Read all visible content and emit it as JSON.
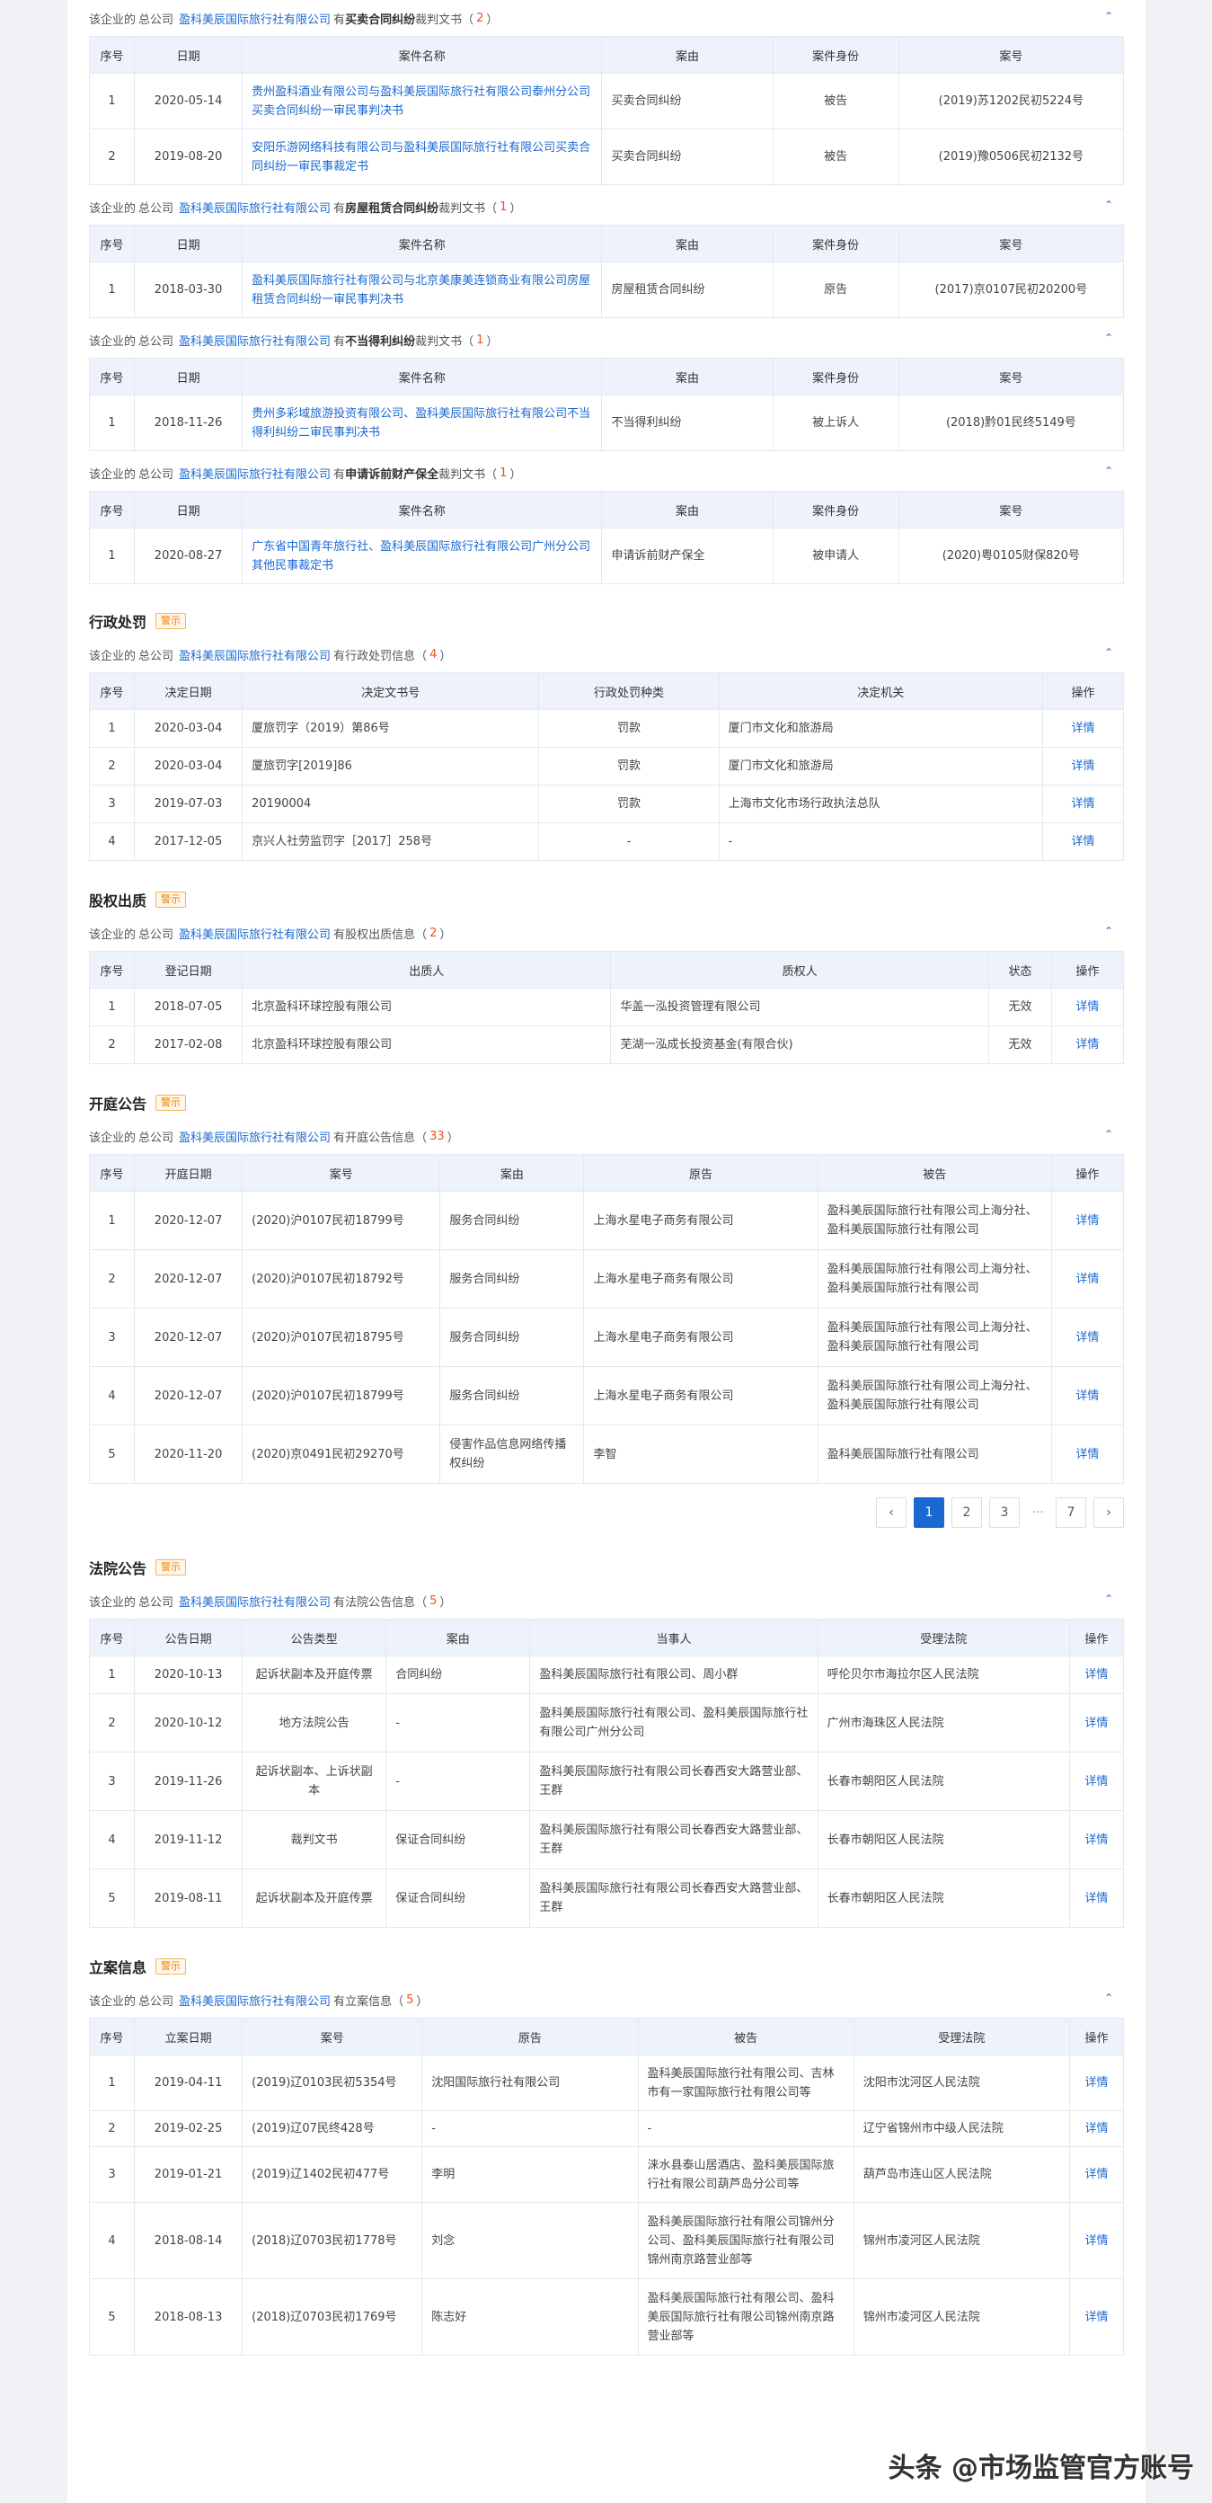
{
  "company": "盈科美辰国际旅行社有限公司",
  "common": {
    "prefix": "该企业的",
    "parent": "总公司",
    "has": "有",
    "paren_open": "（",
    "paren_close": "）",
    "detail": "详情",
    "warn_badge": "警示",
    "collapse": "⌃"
  },
  "judgments": [
    {
      "keyword": "买卖合同纠纷",
      "suffix": "裁判文书",
      "count": "2",
      "headers": [
        "序号",
        "日期",
        "案件名称",
        "案由",
        "案件身份",
        "案号"
      ],
      "rows": [
        [
          "1",
          "2020-05-14",
          "贵州盈科酒业有限公司与盈科美辰国际旅行社有限公司泰州分公司买卖合同纠纷一审民事判决书",
          "买卖合同纠纷",
          "被告",
          "(2019)苏1202民初5224号"
        ],
        [
          "2",
          "2019-08-20",
          "安阳乐游网络科技有限公司与盈科美辰国际旅行社有限公司买卖合同纠纷一审民事裁定书",
          "买卖合同纠纷",
          "被告",
          "(2019)豫0506民初2132号"
        ]
      ]
    },
    {
      "keyword": "房屋租赁合同纠纷",
      "suffix": "裁判文书",
      "count": "1",
      "headers": [
        "序号",
        "日期",
        "案件名称",
        "案由",
        "案件身份",
        "案号"
      ],
      "rows": [
        [
          "1",
          "2018-03-30",
          "盈科美辰国际旅行社有限公司与北京美康美连锁商业有限公司房屋租赁合同纠纷一审民事判决书",
          "房屋租赁合同纠纷",
          "原告",
          "(2017)京0107民初20200号"
        ]
      ]
    },
    {
      "keyword": "不当得利纠纷",
      "suffix": "裁判文书",
      "count": "1",
      "headers": [
        "序号",
        "日期",
        "案件名称",
        "案由",
        "案件身份",
        "案号"
      ],
      "rows": [
        [
          "1",
          "2018-11-26",
          "贵州多彩域旅游投资有限公司、盈科美辰国际旅行社有限公司不当得利纠纷二审民事判决书",
          "不当得利纠纷",
          "被上诉人",
          "(2018)黔01民终5149号"
        ]
      ]
    },
    {
      "keyword": "申请诉前财产保全",
      "suffix": "裁判文书",
      "count": "1",
      "headers": [
        "序号",
        "日期",
        "案件名称",
        "案由",
        "案件身份",
        "案号"
      ],
      "rows": [
        [
          "1",
          "2020-08-27",
          "广东省中国青年旅行社、盈科美辰国际旅行社有限公司广州分公司其他民事裁定书",
          "申请诉前财产保全",
          "被申请人",
          "(2020)粤0105财保820号"
        ]
      ]
    }
  ],
  "admin_penalty": {
    "title": "行政处罚",
    "info": "行政处罚信息",
    "count": "4",
    "headers": [
      "序号",
      "决定日期",
      "决定文书号",
      "行政处罚种类",
      "决定机关",
      "操作"
    ],
    "rows": [
      [
        "1",
        "2020-03-04",
        "厦旅罚字（2019）第86号",
        "罚款",
        "厦门市文化和旅游局"
      ],
      [
        "2",
        "2020-03-04",
        "厦旅罚字[2019]86",
        "罚款",
        "厦门市文化和旅游局"
      ],
      [
        "3",
        "2019-07-03",
        "20190004",
        "罚款",
        "上海市文化市场行政执法总队"
      ],
      [
        "4",
        "2017-12-05",
        "京兴人社劳监罚字［2017］258号",
        "-",
        "-"
      ]
    ]
  },
  "equity_pledge": {
    "title": "股权出质",
    "info": "股权出质信息",
    "count": "2",
    "headers": [
      "序号",
      "登记日期",
      "出质人",
      "质权人",
      "状态",
      "操作"
    ],
    "rows": [
      [
        "1",
        "2018-07-05",
        "北京盈科环球控股有限公司",
        "华盖一泓投资管理有限公司",
        "无效"
      ],
      [
        "2",
        "2017-02-08",
        "北京盈科环球控股有限公司",
        "芜湖一泓成长投资基金(有限合伙)",
        "无效"
      ]
    ]
  },
  "court_session": {
    "title": "开庭公告",
    "info": "开庭公告信息",
    "count": "33",
    "headers": [
      "序号",
      "开庭日期",
      "案号",
      "案由",
      "原告",
      "被告",
      "操作"
    ],
    "rows": [
      [
        "1",
        "2020-12-07",
        "(2020)沪0107民初18799号",
        "服务合同纠纷",
        "上海水星电子商务有限公司",
        "盈科美辰国际旅行社有限公司上海分社、盈科美辰国际旅行社有限公司"
      ],
      [
        "2",
        "2020-12-07",
        "(2020)沪0107民初18792号",
        "服务合同纠纷",
        "上海水星电子商务有限公司",
        "盈科美辰国际旅行社有限公司上海分社、盈科美辰国际旅行社有限公司"
      ],
      [
        "3",
        "2020-12-07",
        "(2020)沪0107民初18795号",
        "服务合同纠纷",
        "上海水星电子商务有限公司",
        "盈科美辰国际旅行社有限公司上海分社、盈科美辰国际旅行社有限公司"
      ],
      [
        "4",
        "2020-12-07",
        "(2020)沪0107民初18799号",
        "服务合同纠纷",
        "上海水星电子商务有限公司",
        "盈科美辰国际旅行社有限公司上海分社、盈科美辰国际旅行社有限公司"
      ],
      [
        "5",
        "2020-11-20",
        "(2020)京0491民初29270号",
        "侵害作品信息网络传播权纠纷",
        "李智",
        "盈科美辰国际旅行社有限公司"
      ]
    ],
    "pager": {
      "prev": "‹",
      "pages": [
        "1",
        "2",
        "3"
      ],
      "dots": "···",
      "last": "7",
      "next": "›"
    }
  },
  "court_notice": {
    "title": "法院公告",
    "info": "法院公告信息",
    "count": "5",
    "headers": [
      "序号",
      "公告日期",
      "公告类型",
      "案由",
      "当事人",
      "受理法院",
      "操作"
    ],
    "rows": [
      [
        "1",
        "2020-10-13",
        "起诉状副本及开庭传票",
        "合同纠纷",
        "盈科美辰国际旅行社有限公司、周小群",
        "呼伦贝尔市海拉尔区人民法院"
      ],
      [
        "2",
        "2020-10-12",
        "地方法院公告",
        "-",
        "盈科美辰国际旅行社有限公司、盈科美辰国际旅行社有限公司广州分公司",
        "广州市海珠区人民法院"
      ],
      [
        "3",
        "2019-11-26",
        "起诉状副本、上诉状副本",
        "-",
        "盈科美辰国际旅行社有限公司长春西安大路营业部、王群",
        "长春市朝阳区人民法院"
      ],
      [
        "4",
        "2019-11-12",
        "裁判文书",
        "保证合同纠纷",
        "盈科美辰国际旅行社有限公司长春西安大路营业部、王群",
        "长春市朝阳区人民法院"
      ],
      [
        "5",
        "2019-08-11",
        "起诉状副本及开庭传票",
        "保证合同纠纷",
        "盈科美辰国际旅行社有限公司长春西安大路营业部、王群",
        "长春市朝阳区人民法院"
      ]
    ]
  },
  "case_filing": {
    "title": "立案信息",
    "info": "立案信息",
    "count": "5",
    "headers": [
      "序号",
      "立案日期",
      "案号",
      "原告",
      "被告",
      "受理法院",
      "操作"
    ],
    "rows": [
      [
        "1",
        "2019-04-11",
        "(2019)辽0103民初5354号",
        "沈阳国际旅行社有限公司",
        "盈科美辰国际旅行社有限公司、吉林市有一家国际旅行社有限公司等",
        "沈阳市沈河区人民法院"
      ],
      [
        "2",
        "2019-02-25",
        "(2019)辽07民终428号",
        "-",
        "-",
        "辽宁省锦州市中级人民法院"
      ],
      [
        "3",
        "2019-01-21",
        "(2019)辽1402民初477号",
        "李明",
        "涞水县泰山居酒店、盈科美辰国际旅行社有限公司葫芦岛分公司等",
        "葫芦岛市连山区人民法院"
      ],
      [
        "4",
        "2018-08-14",
        "(2018)辽0703民初1778号",
        "刘念",
        "盈科美辰国际旅行社有限公司锦州分公司、盈科美辰国际旅行社有限公司锦州南京路营业部等",
        "锦州市凌河区人民法院"
      ],
      [
        "5",
        "2018-08-13",
        "(2018)辽0703民初1769号",
        "陈志好",
        "盈科美辰国际旅行社有限公司、盈科美辰国际旅行社有限公司锦州南京路营业部等",
        "锦州市凌河区人民法院"
      ]
    ]
  },
  "watermark": "头条 @市场监管官方账号"
}
